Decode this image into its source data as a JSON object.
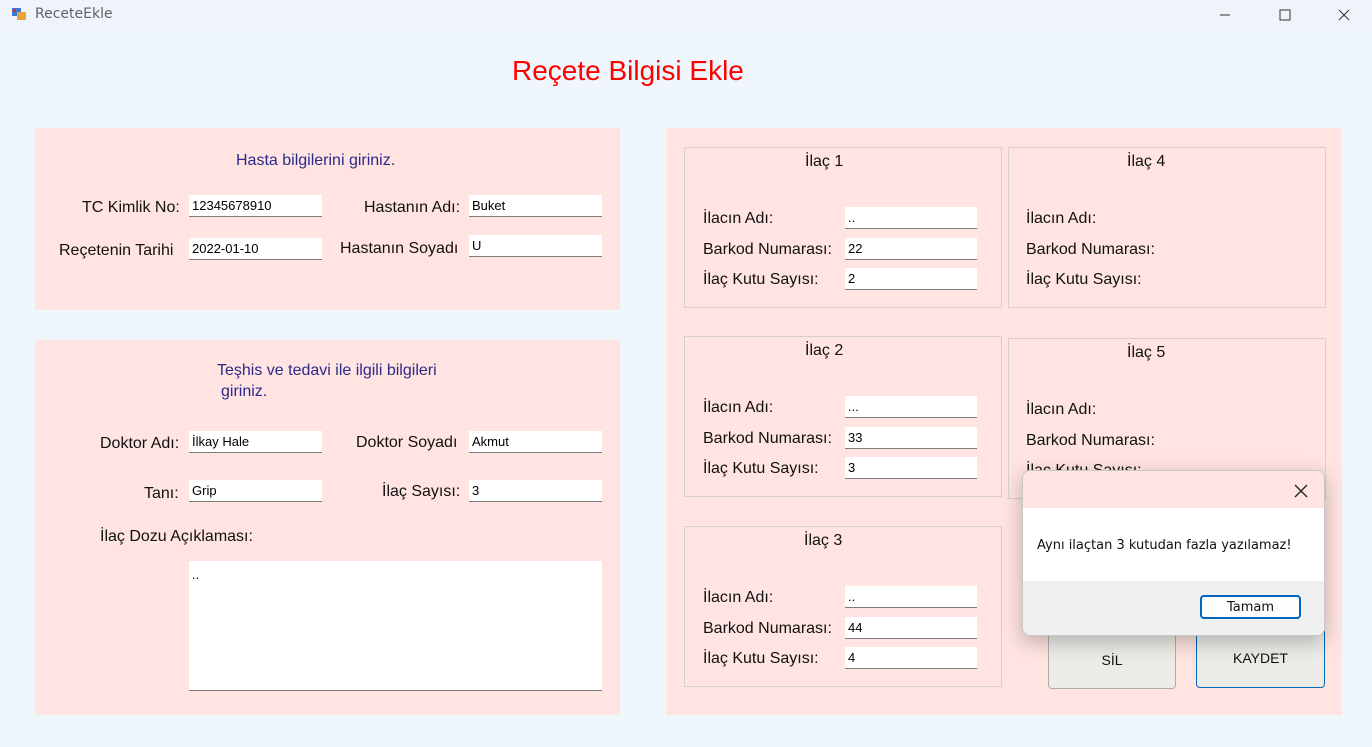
{
  "window": {
    "title": "ReceteEkle"
  },
  "form": {
    "heading": "Reçete Bilgisi Ekle"
  },
  "patient": {
    "header": "Hasta bilgilerini giriniz.",
    "tc_label": "TC Kimlik No:",
    "tc_value": "12345678910",
    "date_label": "Reçetenin Tarihi",
    "date_value": "2022-01-10",
    "name_label": "Hastanın Adı:",
    "name_value": "Buket",
    "surname_label": "Hastanın Soyadı",
    "surname_value": "U"
  },
  "treatment": {
    "header_line1": "Teşhis ve tedavi ile ilgili bilgileri",
    "header_line2": "giriniz.",
    "doctor_name_label": "Doktor Adı:",
    "doctor_name_value": "İlkay Hale",
    "doctor_surname_label": "Doktor Soyadı",
    "doctor_surname_value": "Akmut",
    "diagnosis_label": "Tanı:",
    "diagnosis_value": "Grip",
    "drug_count_label": "İlaç Sayısı:",
    "drug_count_value": "3",
    "dose_label": "İlaç Dozu Açıklaması:",
    "dose_value": ".."
  },
  "drugs": {
    "name_label": "İlacın Adı:",
    "barcode_label": "Barkod Numarası:",
    "box_label": "İlaç Kutu Sayısı:",
    "items": [
      {
        "title": "İlaç 1",
        "name": "..",
        "barcode": "22",
        "boxes": "2"
      },
      {
        "title": "İlaç 2",
        "name": "...",
        "barcode": "33",
        "boxes": "3"
      },
      {
        "title": "İlaç 3",
        "name": "..",
        "barcode": "44",
        "boxes": "4"
      },
      {
        "title": "İlaç 4"
      },
      {
        "title": "İlaç 5"
      }
    ]
  },
  "buttons": {
    "delete": "SİL",
    "save": "KAYDET"
  },
  "dialog": {
    "message": "Aynı ilaçtan 3 kutudan fazla yazılamaz!",
    "ok": "Tamam"
  },
  "colors": {
    "heading": "#ff0000",
    "panel": "#ffe4e1",
    "background": "#eff6fc",
    "accent": "#0067c0"
  },
  "icons": {
    "app": "app-icon",
    "minimize": "minimize-icon",
    "maximize": "maximize-icon",
    "close": "close-icon",
    "dialog_close": "close-icon"
  }
}
